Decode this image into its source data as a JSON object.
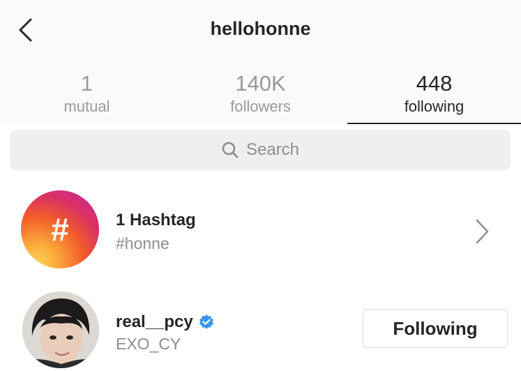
{
  "header": {
    "title": "hellohonne",
    "back_icon": "chevron-left-icon"
  },
  "tabs": [
    {
      "count": "1",
      "label": "mutual",
      "active": false
    },
    {
      "count": "140K",
      "label": "followers",
      "active": false
    },
    {
      "count": "448",
      "label": "following",
      "active": true
    }
  ],
  "search": {
    "icon": "search-icon",
    "placeholder": "Search"
  },
  "list": [
    {
      "type": "hashtag",
      "avatar_icon": "hashtag-icon",
      "avatar_glyph": "#",
      "name": "1 Hashtag",
      "subtitle": "#honne",
      "action_icon": "chevron-right-icon"
    },
    {
      "type": "user",
      "name": "real__pcy",
      "verified": true,
      "verified_icon": "verified-badge-icon",
      "subtitle": "EXO_CY",
      "button_label": "Following"
    }
  ],
  "colors": {
    "header_bg": "#fafafa",
    "text_primary": "#262626",
    "text_secondary": "#8e8e8e",
    "inactive_tab": "#999999",
    "verified_blue": "#3897f0",
    "search_bg": "#efefef"
  }
}
